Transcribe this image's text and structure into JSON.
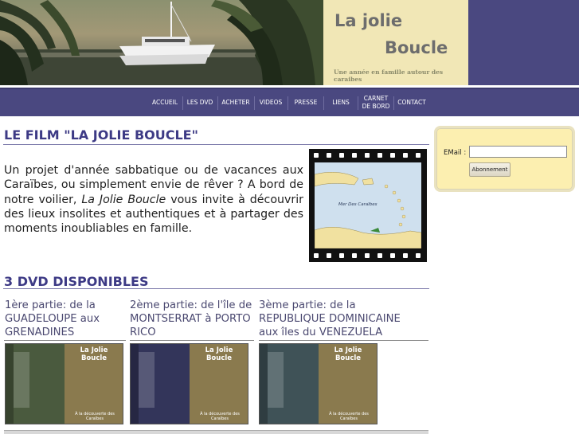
{
  "header": {
    "title_line1": "La jolie",
    "title_line2": "Boucle",
    "tagline": "Une année en famille autour des caraibes"
  },
  "nav": {
    "items": [
      {
        "label": "ACCUEIL"
      },
      {
        "label": "LES DVD"
      },
      {
        "label": "ACHETER"
      },
      {
        "label": "VIDEOS"
      },
      {
        "label": "PRESSE"
      },
      {
        "label": "LIENS"
      },
      {
        "label": "CARNET DE BORD"
      },
      {
        "label": "CONTACT"
      }
    ]
  },
  "film_section": {
    "title": "LE FILM \"LA JOLIE BOUCLE\"",
    "text_before": "Un projet d'année sabbatique ou de vacances aux Caraïbes, ou simplement envie de rêver ? A bord de notre voilier, ",
    "text_emph": "La Jolie Boucle",
    "text_after": " vous invite à découvrir des lieux insolites et authentiques et à partager des moments inoubliables en famille.",
    "map_label": "Mer Des Caraïbes"
  },
  "dvd_section": {
    "title": "3 DVD DISPONIBLES",
    "dvds": [
      {
        "caption": "1ère partie: de la GUADELOUPE aux GRENADINES",
        "cover_title": "La Jolie Boucle",
        "cover_sub": "À la découverte des Caraïbes",
        "color": "#5b6b3c"
      },
      {
        "caption": "2ème partie: de l'île de MONTSERRAT à PORTO RICO",
        "cover_title": "La Jolie Boucle",
        "cover_sub": "À la découverte des Caraïbes",
        "color": "#3d3f63"
      },
      {
        "caption": "3ème partie: de la REPUBLIQUE DOMINICAINE aux îles du VENEZUELA",
        "cover_title": "La Jolie Boucle",
        "cover_sub": "À la découverte des Caraïbes",
        "color": "#4b5b5f"
      }
    ]
  },
  "newsletter": {
    "email_label": "EMail :",
    "email_value": "",
    "button_label": "Abonnement"
  },
  "colors": {
    "nav_bg": "#4a4880",
    "title_box": "#f1e7b6",
    "section_title": "#3d3a85",
    "newsletter_bg": "#fcefb0"
  }
}
